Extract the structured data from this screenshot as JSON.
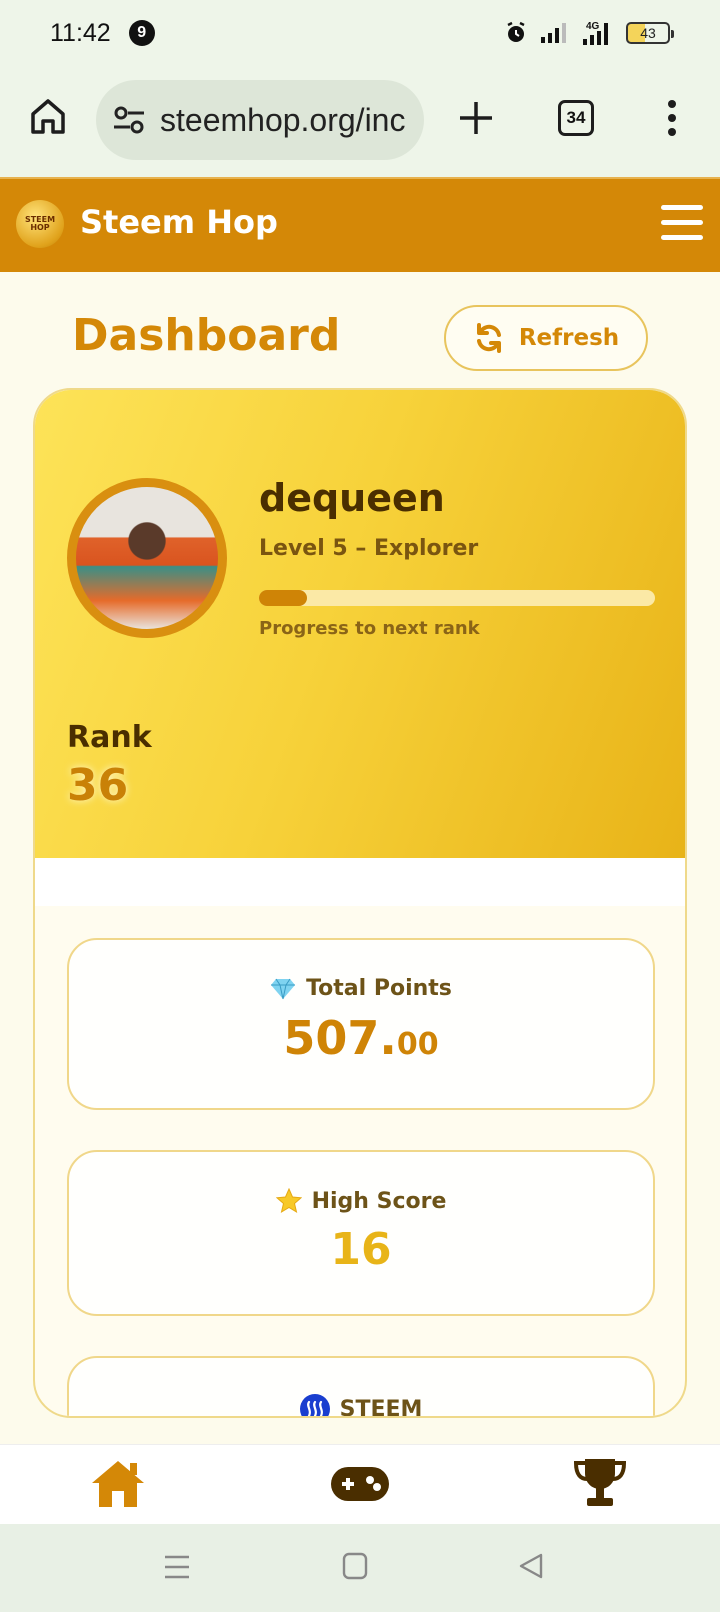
{
  "status_bar": {
    "time": "11:42",
    "notification_count": "9",
    "network": "4G",
    "battery": "43"
  },
  "browser": {
    "url": "steemhop.org/inc",
    "tab_count": "34"
  },
  "app": {
    "title": "Steem Hop",
    "logo_text": "STEEM HOP",
    "brand_color": "#d48807",
    "accent_color": "#f7d23a"
  },
  "dashboard": {
    "title": "Dashboard",
    "refresh_label": "Refresh"
  },
  "profile": {
    "username": "dequeen",
    "level": "Level 5 – Explorer",
    "progress_fraction": 0.12,
    "progress_label": "Progress to next rank",
    "rank_label": "Rank",
    "rank_value": "36"
  },
  "stats": {
    "total_points": {
      "icon": "gem-icon",
      "label": "Total Points",
      "value_int": "507.",
      "value_dec": "00"
    },
    "high_score": {
      "icon": "star-icon",
      "label": "High Score",
      "value": "16"
    },
    "steem": {
      "icon": "steem-logo-icon",
      "label": "STEEM"
    }
  },
  "bottom_nav": {
    "items": [
      "home-icon",
      "gamepad-icon",
      "trophy-icon"
    ]
  }
}
